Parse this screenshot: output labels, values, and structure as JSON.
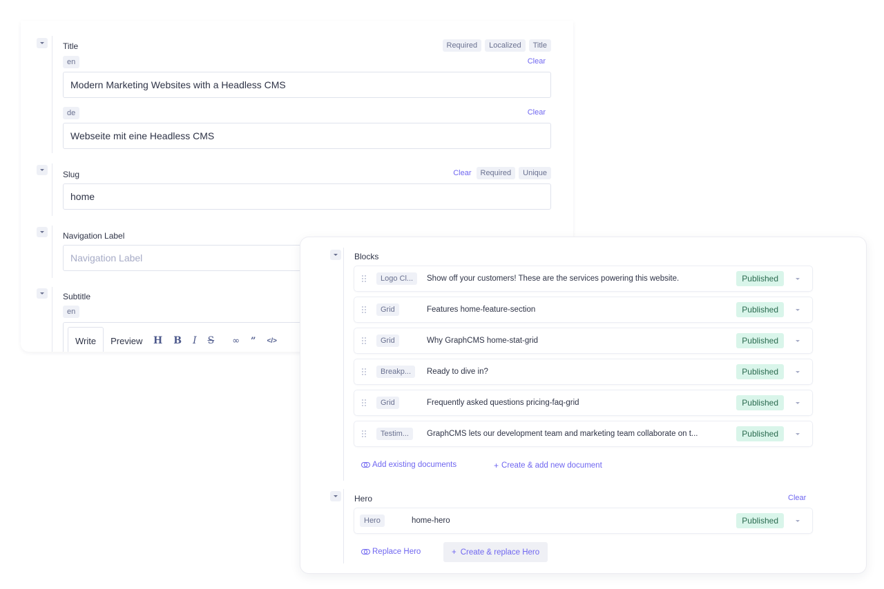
{
  "form": {
    "title_field": {
      "label": "Title",
      "tags": [
        "Required",
        "Localized",
        "Title"
      ],
      "locales": [
        {
          "code": "en",
          "clear_label": "Clear",
          "value": "Modern Marketing Websites with a Headless CMS"
        },
        {
          "code": "de",
          "clear_label": "Clear",
          "value": "Webseite mit eine Headless CMS"
        }
      ]
    },
    "slug_field": {
      "label": "Slug",
      "clear_label": "Clear",
      "tags": [
        "Required",
        "Unique"
      ],
      "value": "home"
    },
    "navigation_label_field": {
      "label": "Navigation Label",
      "placeholder": "Navigation Label",
      "value": ""
    },
    "subtitle_field": {
      "label": "Subtitle",
      "locale": "en",
      "editor_tabs": [
        "Write",
        "Preview"
      ],
      "active_tab": "Write",
      "toolbar": [
        {
          "icon": "heading-icon",
          "glyph": "H"
        },
        {
          "icon": "bold-icon",
          "glyph": "B"
        },
        {
          "icon": "italic-icon",
          "glyph": "I"
        },
        {
          "icon": "strikethrough-icon",
          "glyph": "S"
        },
        {
          "icon": "link-icon",
          "glyph": "🔗"
        },
        {
          "icon": "quote-icon",
          "glyph": "99"
        },
        {
          "icon": "code-icon",
          "glyph": "</>"
        }
      ]
    }
  },
  "overlay": {
    "blocks_field": {
      "label": "Blocks",
      "rows": [
        {
          "type": "Logo Cl...",
          "title": "Show off your customers! These are the services powering this website.",
          "status": "Published"
        },
        {
          "type": "Grid",
          "title": "Features home-feature-section",
          "status": "Published"
        },
        {
          "type": "Grid",
          "title": "Why GraphCMS home-stat-grid",
          "status": "Published"
        },
        {
          "type": "Breakp...",
          "title": "Ready to dive in?",
          "status": "Published"
        },
        {
          "type": "Grid",
          "title": "Frequently asked questions pricing-faq-grid",
          "status": "Published"
        },
        {
          "type": "Testim...",
          "title": "GraphCMS lets our development team and marketing team collaborate on t...",
          "status": "Published"
        }
      ],
      "add_existing_label": "Add existing documents",
      "create_new_label": "Create & add new document"
    },
    "hero_field": {
      "label": "Hero",
      "clear_label": "Clear",
      "row": {
        "type": "Hero",
        "title": "home-hero",
        "status": "Published"
      },
      "replace_label": "Replace Hero",
      "create_replace_label": "Create & replace Hero"
    }
  },
  "colors": {
    "accent": "#6f66f0",
    "published_bg": "#d9f5ea",
    "published_text": "#2a6a4f",
    "chip_bg": "#eff1f7"
  }
}
